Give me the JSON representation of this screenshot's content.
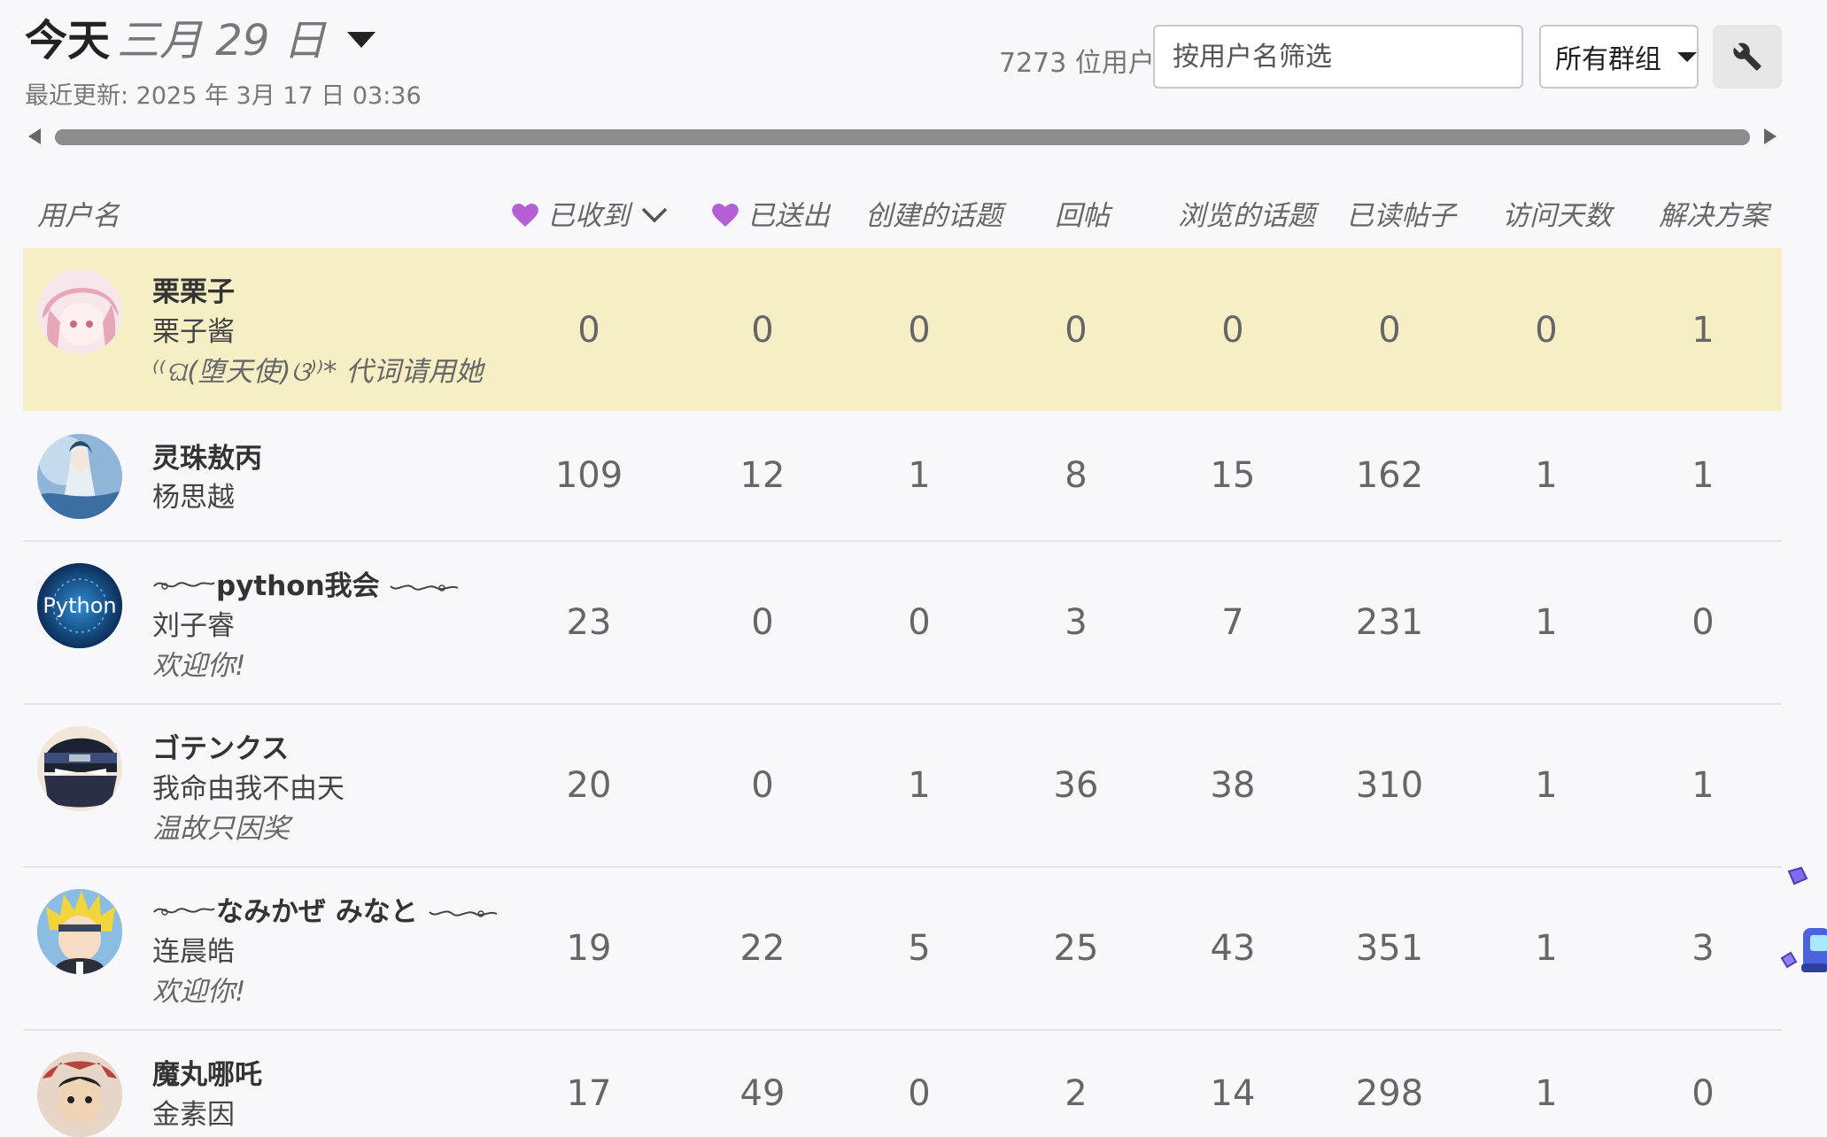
{
  "header": {
    "period_label": "今天",
    "date_label": "三月 29 日",
    "last_updated": "最近更新:  2025 年 3月 17 日 03:36"
  },
  "controls": {
    "user_count": "7273 位用户",
    "filter_placeholder": "按用户名筛选",
    "group_select": "所有群组"
  },
  "columns": {
    "username": "用户名",
    "likes_received": "已收到",
    "likes_given": "已送出",
    "topics_created": "创建的话题",
    "replies": "回帖",
    "topics_viewed": "浏览的话题",
    "posts_read": "已读帖子",
    "days_visited": "访问天数",
    "solutions": "解决方案"
  },
  "colors": {
    "heart": "#b55fd6",
    "highlight_row": "#f6eec4"
  },
  "rows": [
    {
      "username": "栗栗子",
      "name": "栗子酱",
      "title": "⁽⁽ଘ(堕天使)ଓ⁾⁾* 代词请用她",
      "values": [
        "0",
        "0",
        "0",
        "0",
        "0",
        "0",
        "0",
        "1"
      ],
      "highlighted": true
    },
    {
      "username": "灵珠敖丙",
      "name": "杨思越",
      "title": "",
      "values": [
        "109",
        "12",
        "1",
        "8",
        "15",
        "162",
        "1",
        "1"
      ],
      "highlighted": false
    },
    {
      "username": "python我会",
      "name": "刘子睿",
      "title": "欢迎你!",
      "values": [
        "23",
        "0",
        "0",
        "3",
        "7",
        "231",
        "1",
        "0"
      ],
      "highlighted": false,
      "avatar_text": "Python"
    },
    {
      "username": "ゴテンクス",
      "name": "我命由我不由天",
      "title": "温故只因奖",
      "values": [
        "20",
        "0",
        "1",
        "36",
        "38",
        "310",
        "1",
        "1"
      ],
      "highlighted": false
    },
    {
      "username": "なみかぜ みなと",
      "name": "连晨皓",
      "title": "欢迎你!",
      "values": [
        "19",
        "22",
        "5",
        "25",
        "43",
        "351",
        "1",
        "3"
      ],
      "highlighted": false
    },
    {
      "username": "魔丸哪吒",
      "name": "金素因",
      "title": "",
      "values": [
        "17",
        "49",
        "0",
        "2",
        "14",
        "298",
        "1",
        "0"
      ],
      "highlighted": false
    }
  ]
}
